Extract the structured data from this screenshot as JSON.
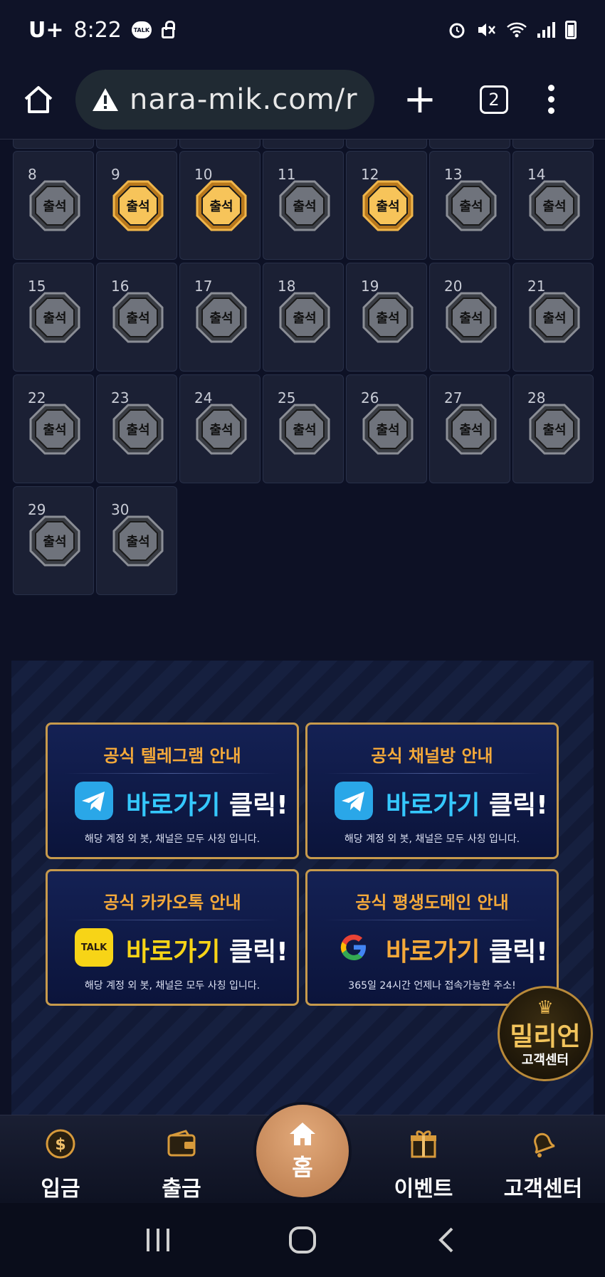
{
  "status_bar": {
    "carrier": "U+",
    "time": "8:22",
    "talk_badge": "TALK"
  },
  "browser": {
    "url": "nara-mik.com/r",
    "tab_count": "2"
  },
  "calendar": {
    "stamp_label": "출석",
    "days": [
      {
        "day": "8",
        "checked": false
      },
      {
        "day": "9",
        "checked": true
      },
      {
        "day": "10",
        "checked": true
      },
      {
        "day": "11",
        "checked": false
      },
      {
        "day": "12",
        "checked": true
      },
      {
        "day": "13",
        "checked": false
      },
      {
        "day": "14",
        "checked": false
      },
      {
        "day": "15",
        "checked": false
      },
      {
        "day": "16",
        "checked": false
      },
      {
        "day": "17",
        "checked": false
      },
      {
        "day": "18",
        "checked": false
      },
      {
        "day": "19",
        "checked": false
      },
      {
        "day": "20",
        "checked": false
      },
      {
        "day": "21",
        "checked": false
      },
      {
        "day": "22",
        "checked": false
      },
      {
        "day": "23",
        "checked": false
      },
      {
        "day": "24",
        "checked": false
      },
      {
        "day": "25",
        "checked": false
      },
      {
        "day": "26",
        "checked": false
      },
      {
        "day": "27",
        "checked": false
      },
      {
        "day": "28",
        "checked": false
      },
      {
        "day": "29",
        "checked": false
      },
      {
        "day": "30",
        "checked": false
      }
    ]
  },
  "promo": {
    "cards": [
      {
        "title": "공식 텔레그램 안내",
        "cta": "바로가기 클릭!",
        "note": "해당 계정 외 봇, 채널은 모두 사칭 입니다.",
        "icon": "telegram-icon"
      },
      {
        "title": "공식 채널방 안내",
        "cta": "바로가기 클릭!",
        "note": "해당 계정 외 봇, 채널은 모두 사칭 입니다.",
        "icon": "telegram-icon"
      },
      {
        "title": "공식 카카오톡 안내",
        "cta": "바로가기 클릭!",
        "note": "해당 계정 외 봇, 채널은 모두 사칭 입니다.",
        "icon": "kakaotalk-icon",
        "icon_text": "TALK"
      },
      {
        "title": "공식 평생도메인 안내",
        "cta": "바로가기 클릭!",
        "note": "365일 24시간 언제나 접속가능한 주소!",
        "icon": "google-icon"
      }
    ],
    "cs_badge": {
      "brand": "밀리언",
      "sub": "고객센터"
    }
  },
  "bottom_nav": {
    "deposit": "입금",
    "withdraw": "출금",
    "home": "홈",
    "event": "이벤트",
    "support": "고객센터"
  },
  "colors": {
    "gold": "#f4a93a",
    "bg": "#0d1125",
    "cell": "#1b2034"
  }
}
